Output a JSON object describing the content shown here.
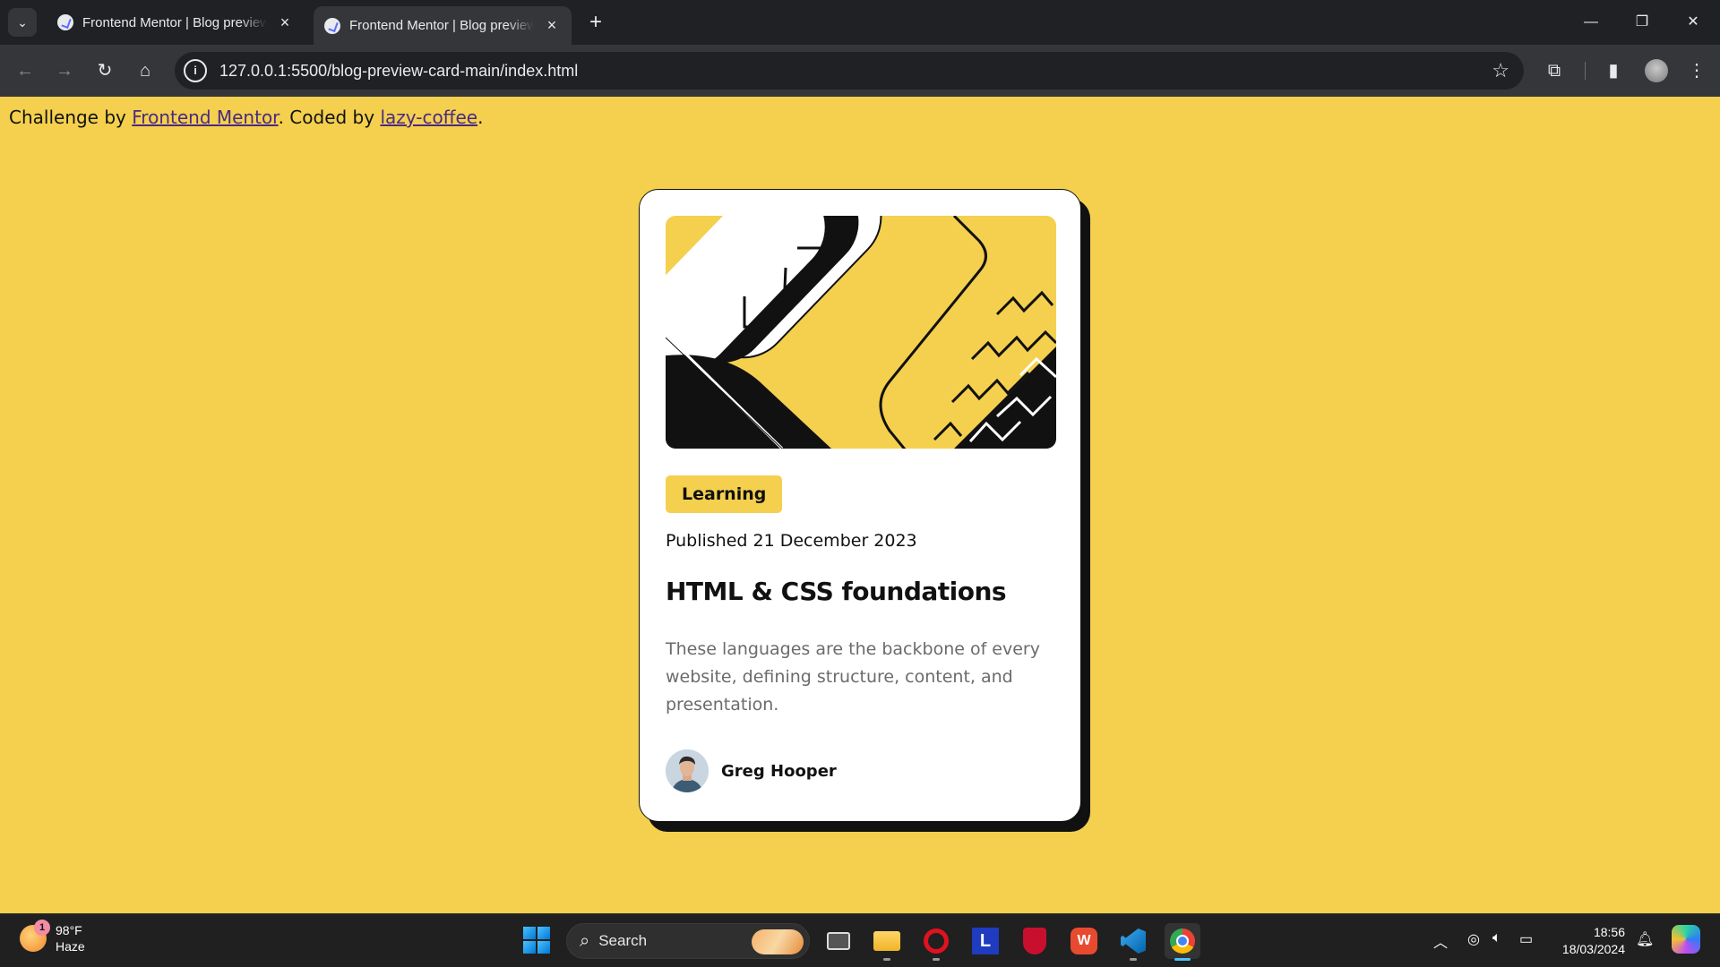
{
  "browser": {
    "tabs": [
      {
        "title": "Frontend Mentor | Blog preview card",
        "active": false
      },
      {
        "title": "Frontend Mentor | Blog preview card",
        "active": true
      }
    ],
    "url": "127.0.0.1:5500/blog-preview-card-main/index.html"
  },
  "attribution": {
    "prefix": "Challenge by ",
    "link1": "Frontend Mentor",
    "middle": ". Coded by ",
    "link2": "lazy-coffee",
    "suffix": "."
  },
  "card": {
    "tag": "Learning",
    "published": "Published 21 December 2023",
    "title": "HTML & CSS foundations",
    "description": "These languages are the backbone of every website, defining structure, content, and presentation.",
    "author": "Greg Hooper"
  },
  "taskbar": {
    "weather_badge": "1",
    "temperature": "98°F",
    "condition": "Haze",
    "search_label": "Search",
    "time": "18:56",
    "date": "18/03/2024",
    "apps": [
      "task-view",
      "file-explorer",
      "opera",
      "l-app",
      "mcafee",
      "wps-office",
      "vscode",
      "chrome"
    ]
  },
  "colors": {
    "page_background": "#f4d04e",
    "card": "#ffffff",
    "text": "#111111",
    "muted_text": "#6b6b6b",
    "link": "#4b2a82"
  }
}
